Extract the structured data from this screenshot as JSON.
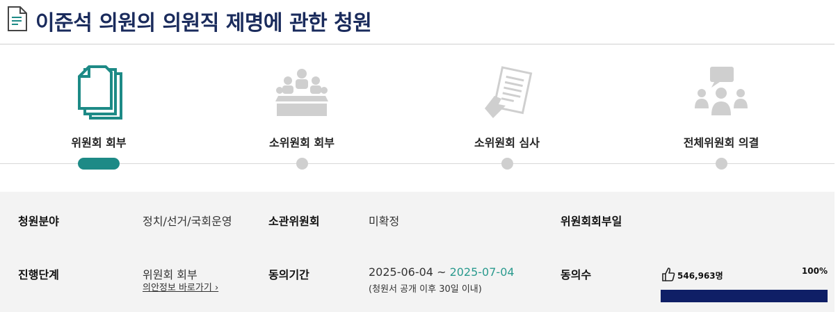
{
  "title": "이준석 의원의 의원직 제명에 관한 청원",
  "steps": [
    {
      "label": "위원회 회부",
      "icon": "documents-icon",
      "active": true
    },
    {
      "label": "소위원회 회부",
      "icon": "meeting-table-icon",
      "active": false
    },
    {
      "label": "소위원회 심사",
      "icon": "review-document-icon",
      "active": false
    },
    {
      "label": "전체위원회 의결",
      "icon": "discussion-icon",
      "active": false
    }
  ],
  "colors": {
    "accent": "#1d8a86",
    "title": "#1a2b5c",
    "progress": "#0f1f66",
    "inactive": "#cfcfcf",
    "period_end": "#2a9a8e"
  },
  "info": {
    "category_label": "청원분야",
    "category_value": "정치/선거/국회운영",
    "committee_label": "소관위원회",
    "committee_value": "미확정",
    "referral_date_label": "위원회회부일",
    "referral_date_value": "",
    "stage_label": "진행단계",
    "stage_value": "위원회 회부",
    "bill_link": "의안정보 바로가기 ›",
    "period_label": "동의기간",
    "period_start": "2025-06-04",
    "period_sep": " ~ ",
    "period_end": "2025-07-04",
    "period_note": "(청원서 공개 이후 30일 이내)",
    "agree_label": "동의수",
    "agree_count": "546,963명",
    "agree_percent": "100%",
    "agree_progress": 1.0
  }
}
